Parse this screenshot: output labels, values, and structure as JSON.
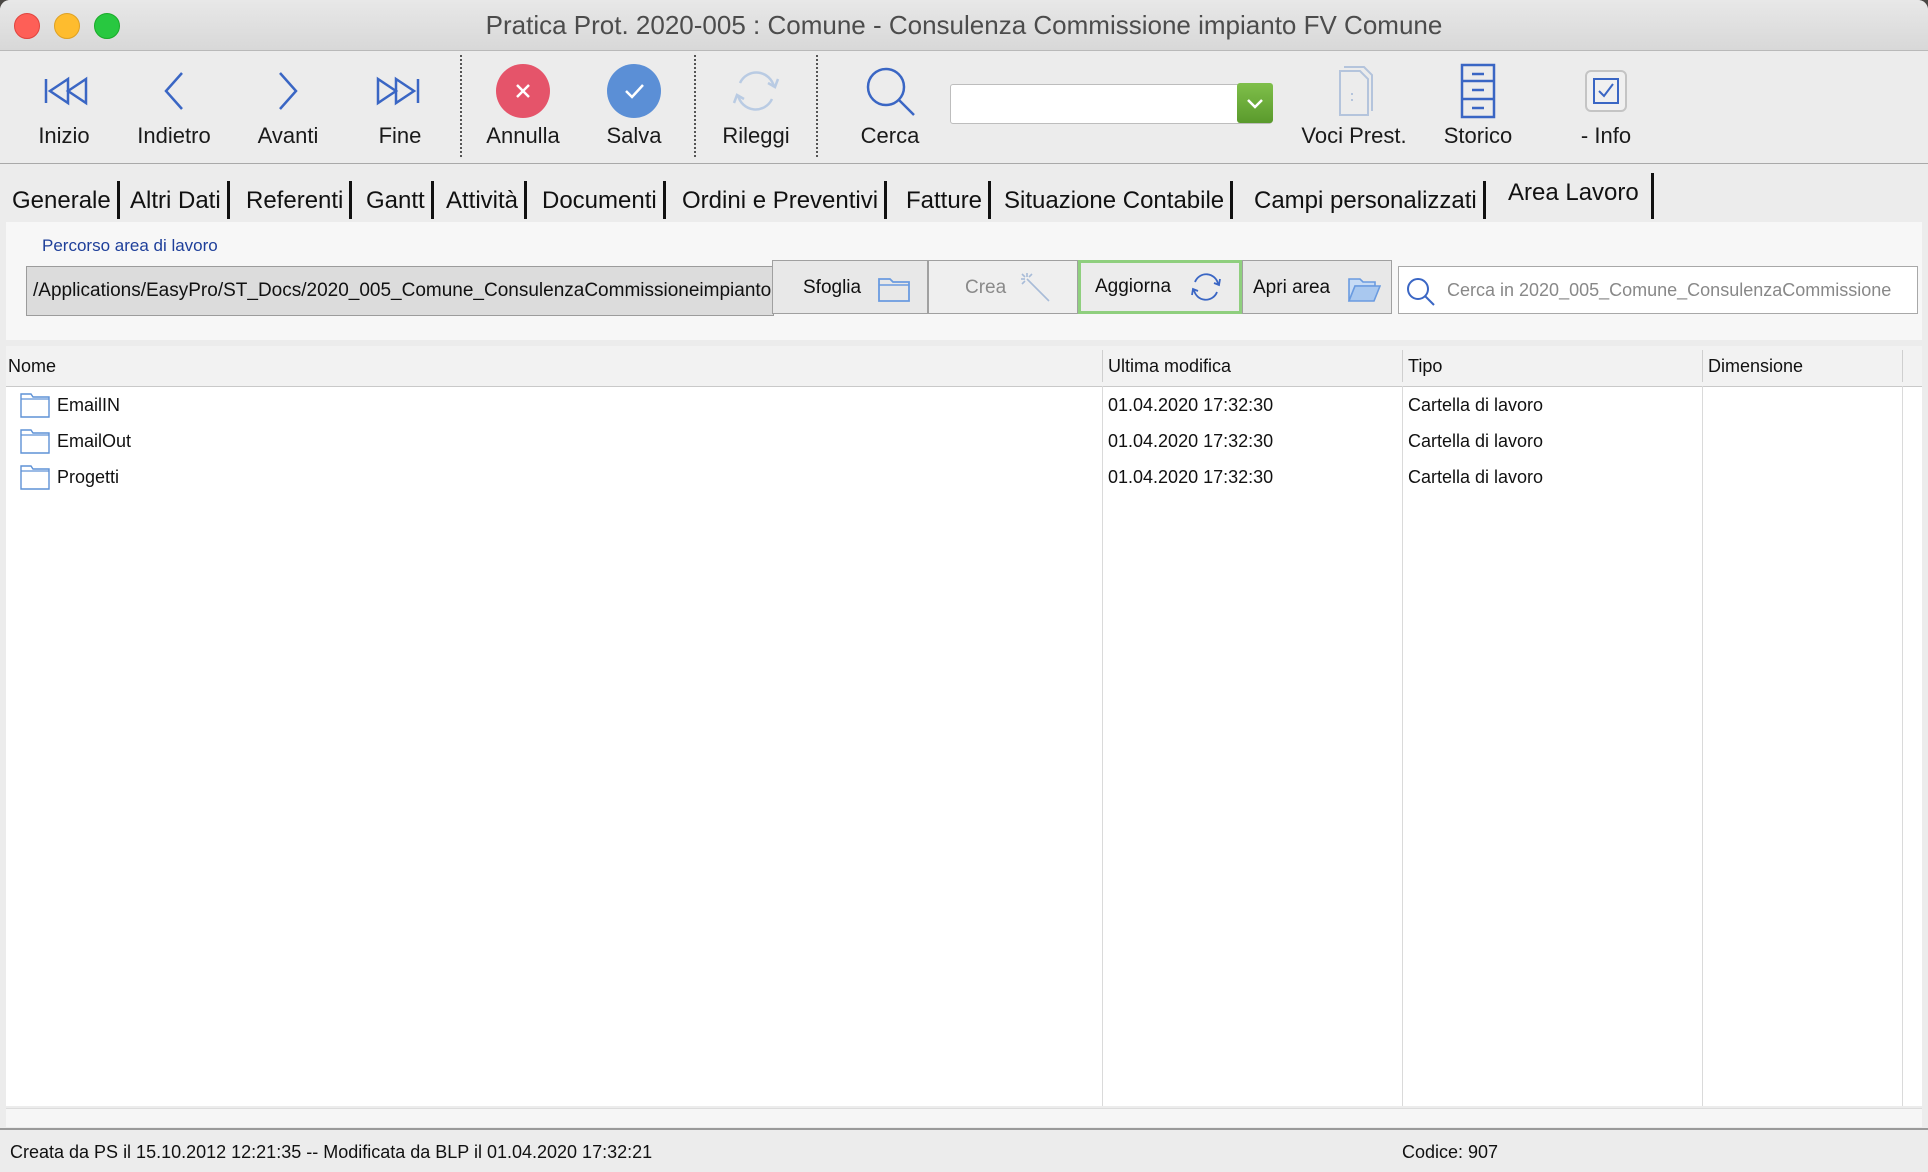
{
  "window": {
    "title": "Pratica Prot. 2020-005 : Comune  - Consulenza Commissione impianto FV Comune"
  },
  "toolbar": {
    "first": "Inizio",
    "back": "Indietro",
    "forward": "Avanti",
    "last": "Fine",
    "cancel": "Annulla",
    "save": "Salva",
    "reload": "Rileggi",
    "search": "Cerca",
    "combo_value": "",
    "items": "Voci Prest.",
    "history": "Storico",
    "info": "- Info"
  },
  "tabs": [
    {
      "label": "Generale"
    },
    {
      "label": "Altri Dati"
    },
    {
      "label": "Referenti"
    },
    {
      "label": "Gantt"
    },
    {
      "label": "Attività"
    },
    {
      "label": "Documenti"
    },
    {
      "label": "Ordini e Preventivi"
    },
    {
      "label": "Fatture"
    },
    {
      "label": "Situazione Contabile"
    },
    {
      "label": "Campi personalizzati"
    },
    {
      "label": "Area Lavoro"
    }
  ],
  "work_area": {
    "path_label": "Percorso area di lavoro",
    "path_value": "/Applications/EasyPro/ST_Docs/2020_005_Comune_ConsulenzaCommissioneimpianto",
    "browse": "Sfoglia",
    "create": "Crea",
    "refresh": "Aggiorna",
    "open": "Apri area",
    "search_placeholder": "Cerca in 2020_005_Comune_ConsulenzaCommissione"
  },
  "file_list": {
    "columns": [
      "Nome",
      "Ultima modifica",
      "Tipo",
      "Dimensione"
    ],
    "rows": [
      {
        "name": "EmailIN",
        "modified": "01.04.2020 17:32:30",
        "type": "Cartella di lavoro",
        "size": ""
      },
      {
        "name": "EmailOut",
        "modified": "01.04.2020 17:32:30",
        "type": "Cartella di lavoro",
        "size": ""
      },
      {
        "name": "Progetti",
        "modified": "01.04.2020 17:32:30",
        "type": "Cartella di lavoro",
        "size": ""
      }
    ]
  },
  "status": {
    "created": "Creata da PS il 15.10.2012 12:21:35 -- Modificata da BLP il 01.04.2020 17:32:21",
    "code": "Codice: 907"
  },
  "colors": {
    "cancel": "#e5546a",
    "save": "#5b8fd6",
    "accent": "#3a66c4",
    "focus": "#8fcf7e"
  }
}
